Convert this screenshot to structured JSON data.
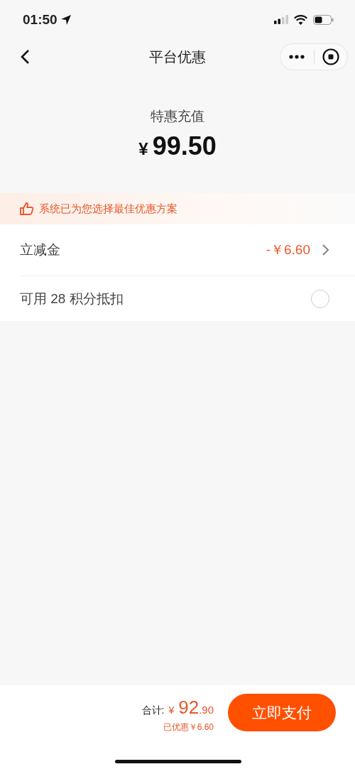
{
  "status_bar": {
    "time": "01:50"
  },
  "nav": {
    "title": "平台优惠"
  },
  "header": {
    "label": "特惠充值",
    "currency": "¥",
    "amount": "99.50"
  },
  "banner": {
    "text": "系统已为您选择最佳优惠方案"
  },
  "rows": [
    {
      "kind": "discount",
      "label": "立减金",
      "value": "-￥6.60"
    },
    {
      "kind": "points",
      "label": "可用 28 积分抵扣",
      "checked": false
    }
  ],
  "footer": {
    "total_label": "合计:",
    "currency": "¥",
    "total_int": "92",
    "total_dec": ".90",
    "saved": "已优惠￥6.60",
    "pay_button": "立即支付"
  }
}
